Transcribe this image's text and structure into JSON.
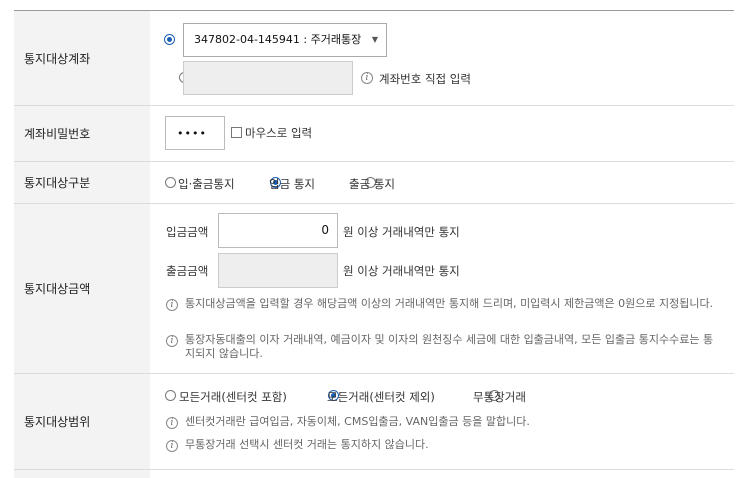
{
  "account": {
    "label": "통지대상계좌",
    "select_value": "347802-04-145941 : 주거래통장",
    "direct_hint": "계좌번호 직접 입력"
  },
  "password": {
    "label": "계좌비밀번호",
    "value": "••••",
    "mouse_label": "마우스로 입력"
  },
  "notice_type": {
    "label": "통지대상구분",
    "options": [
      "입·출금통지",
      "입금 통지",
      "출금 통지"
    ],
    "selected_index": 1
  },
  "amount": {
    "label": "통지대상금액",
    "deposit_label": "입금금액",
    "deposit_value": "0",
    "deposit_suffix": "원 이상 거래내역만 통지",
    "withdraw_label": "출금금액",
    "withdraw_suffix": "원 이상 거래내역만 통지",
    "note1": "통지대상금액을 입력할 경우 해당금액 이상의 거래내역만 통지해 드리며, 미입력시 제한금액은 0원으로 지정됩니다.",
    "note2": "통장자동대출의 이자 거래내역, 예금이자 및 이자의 원천징수 세금에 대한 입출금내역, 모든 입출금 통지수수료는 통지되지 않습니다."
  },
  "scope": {
    "label": "통지대상범위",
    "options": [
      "모든거래(센터컷 포함)",
      "모든거래(센터컷 제외)",
      "무통장거래"
    ],
    "selected_index": 1,
    "note1": "센터컷거래란 급여입금, 자동이체, CMS입출금, VAN입출금 등을 말합니다.",
    "note2": "무통장거래 선택시 센터컷 거래는 통지하지 않습니다."
  },
  "info_icon_glyph": "i",
  "accent_color": "#1a5fb4"
}
